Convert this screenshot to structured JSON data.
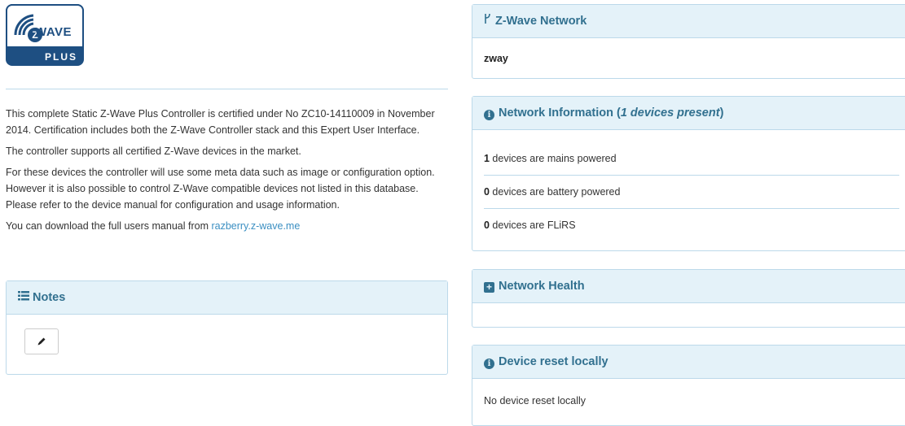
{
  "logo": {
    "brand_text": "WAVE",
    "brand_letter": "Z",
    "plus_text": "PLUS"
  },
  "intro": {
    "p1": "This complete Static Z-Wave Plus Controller is certified under No ZC10-14110009 in November 2014. Certification includes both the Z-Wave Controller stack and this Expert User Interface.",
    "p2": "The controller supports all certified Z-Wave devices in the market.",
    "p3": "For these devices the controller will use some meta data such as image or configuration option. However it is also possible to control Z-Wave compatible devices not listed in this database. Please refer to the device manual for configuration and usage information.",
    "p4_prefix": "You can download the full users manual from ",
    "p4_link": "razberry.z-wave.me"
  },
  "notes": {
    "title": "Notes",
    "icon": "list-icon",
    "edit_icon": "pencil-icon"
  },
  "network": {
    "title": "Z-Wave Network",
    "icon": "network-icon",
    "name": "zway"
  },
  "network_info": {
    "title_prefix": "Network Information (",
    "title_italic": "1 devices present",
    "title_suffix": ")",
    "icon": "info-circle-icon",
    "rows": [
      {
        "count": "1",
        "text": " devices are mains powered"
      },
      {
        "count": "0",
        "text": " devices are battery powered"
      },
      {
        "count": "0",
        "text": " devices are FLiRS"
      }
    ]
  },
  "network_health": {
    "title": "Network Health",
    "icon": "plus-square-icon"
  },
  "device_reset": {
    "title": "Device reset locally",
    "icon": "info-circle-icon",
    "message": "No device reset locally"
  },
  "colors": {
    "accent": "#31708f",
    "panel_heading_bg": "#e4f2f9",
    "border": "#bcd9ea",
    "link": "#3b8fc2",
    "logo_blue": "#1e4f82"
  }
}
